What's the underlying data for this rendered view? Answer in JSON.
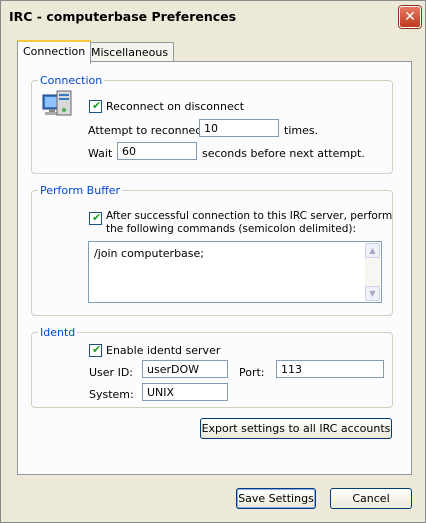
{
  "window": {
    "title": "IRC - computerbase Preferences",
    "close_glyph": "✕"
  },
  "tabs": [
    {
      "label": "Connection"
    },
    {
      "label": "Miscellaneous"
    }
  ],
  "connection": {
    "legend": "Connection",
    "reconnect_label": "Reconnect on disconnect",
    "reconnect_checked": true,
    "attempt_label": "Attempt to reconnect",
    "attempt_value": "10",
    "times_label": "times.",
    "wait_label": "Wait",
    "wait_value": "60",
    "seconds_label": "seconds before next attempt.",
    "icon": "computer-network-icon"
  },
  "perform": {
    "legend": "Perform Buffer",
    "checkbox_label_line1": "After successful connection to this IRC server, perform",
    "checkbox_label_line2": "the following commands (semicolon delimited):",
    "checked": true,
    "commands": "/join computerbase;"
  },
  "identd": {
    "legend": "Identd",
    "enable_label": "Enable identd server",
    "enabled": true,
    "userid_label": "User ID:",
    "userid_value": "userDOW",
    "port_label": "Port:",
    "port_value": "113",
    "system_label": "System:",
    "system_value": "UNIX"
  },
  "buttons": {
    "export": "Export settings to all IRC accounts",
    "save": "Save Settings",
    "cancel": "Cancel"
  }
}
